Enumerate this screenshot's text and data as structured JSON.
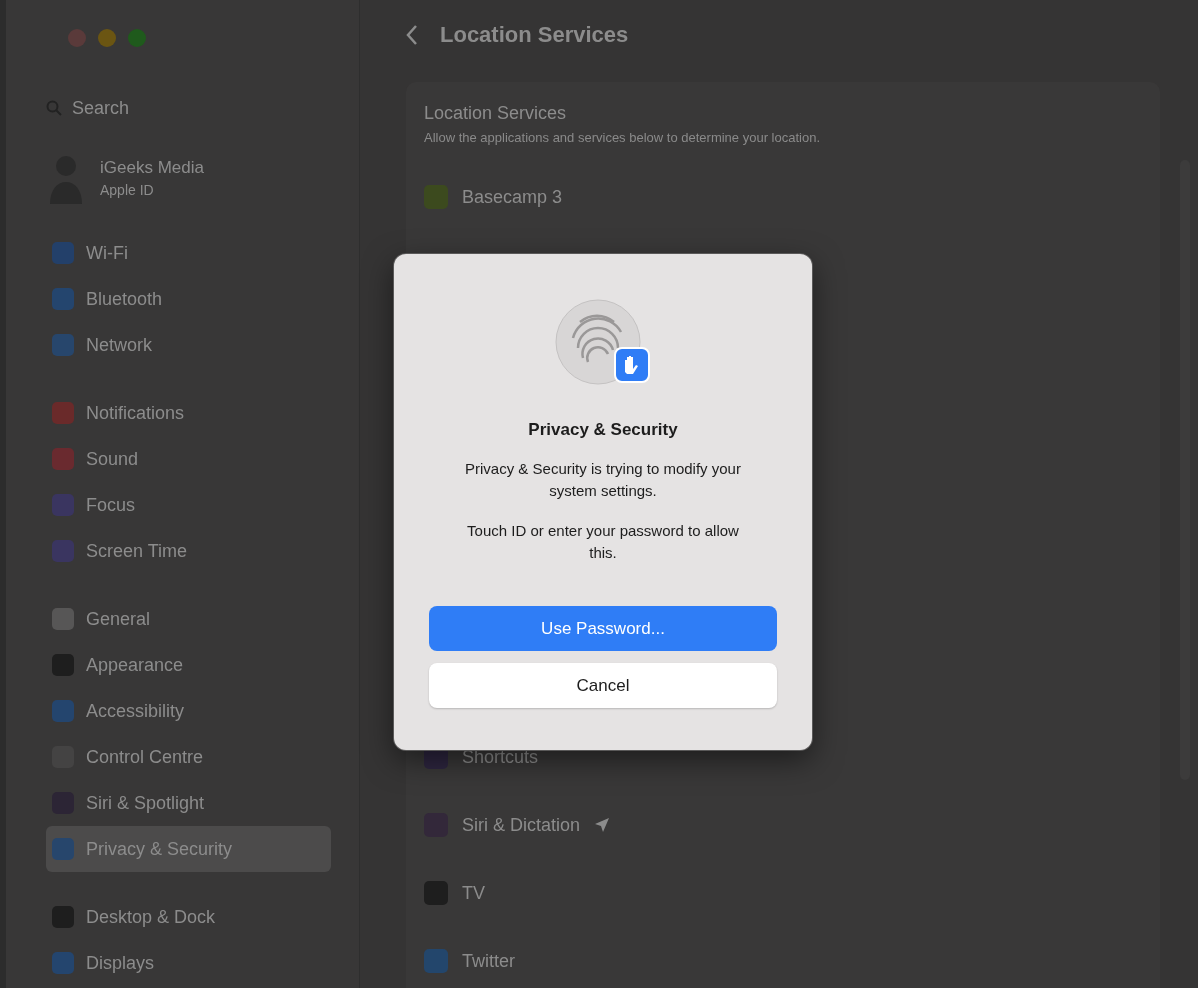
{
  "sidebar": {
    "search": {
      "placeholder": "Search"
    },
    "account": {
      "name": "iGeeks Media",
      "subtitle": "Apple ID"
    },
    "groups": [
      [
        {
          "label": "Wi-Fi",
          "color": "#23406a",
          "selected": false
        },
        {
          "label": "Bluetooth",
          "color": "#24456e",
          "selected": false
        },
        {
          "label": "Network",
          "color": "#27466c",
          "selected": false
        }
      ],
      [
        {
          "label": "Notifications",
          "color": "#6a2a2a",
          "selected": false
        },
        {
          "label": "Sound",
          "color": "#6a2a2f",
          "selected": false
        },
        {
          "label": "Focus",
          "color": "#3a3560",
          "selected": false
        },
        {
          "label": "Screen Time",
          "color": "#3a3560",
          "selected": false
        }
      ],
      [
        {
          "label": "General",
          "color": "#575656",
          "selected": false
        },
        {
          "label": "Appearance",
          "color": "#1e1e1e",
          "selected": false
        },
        {
          "label": "Accessibility",
          "color": "#24456e",
          "selected": false
        },
        {
          "label": "Control Centre",
          "color": "#444343",
          "selected": false
        },
        {
          "label": "Siri & Spotlight",
          "color": "#2c2535",
          "selected": false
        },
        {
          "label": "Privacy & Security",
          "color": "#27466c",
          "selected": true
        }
      ],
      [
        {
          "label": "Desktop & Dock",
          "color": "#1e1e1e",
          "selected": false
        },
        {
          "label": "Displays",
          "color": "#24456e",
          "selected": false
        }
      ]
    ]
  },
  "main": {
    "title": "Location Services",
    "card": {
      "title": "Location Services",
      "description": "Allow the applications and services below to determine your location."
    },
    "apps_top": [
      {
        "name": "Basecamp 3",
        "color": "#3c4a1e",
        "location_indicator": false
      }
    ],
    "apps_bottom": [
      {
        "name": "Shortcuts",
        "color": "#2e2640",
        "location_indicator": false
      },
      {
        "name": "Siri & Dictation",
        "color": "#33283a",
        "location_indicator": true
      },
      {
        "name": "TV",
        "color": "#1e1e1e",
        "location_indicator": false
      },
      {
        "name": "Twitter",
        "color": "#23466c",
        "location_indicator": false
      }
    ]
  },
  "dialog": {
    "title": "Privacy & Security",
    "message": "Privacy & Security is trying to modify your system settings.",
    "note": "Touch ID or enter your password to allow this.",
    "buttons": [
      {
        "label": "Use Password...",
        "kind": "primary"
      },
      {
        "label": "Cancel",
        "kind": "secondary"
      }
    ]
  }
}
